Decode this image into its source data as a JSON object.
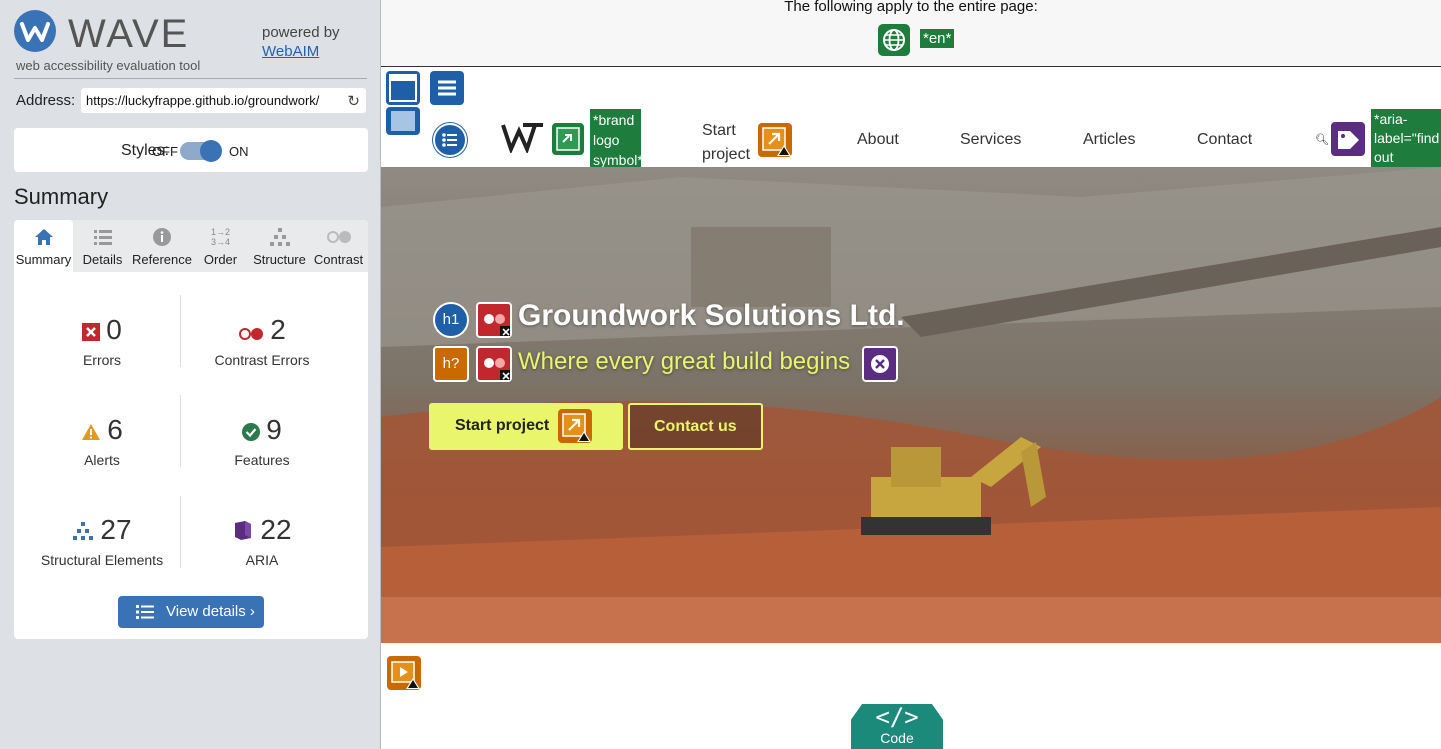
{
  "wave": {
    "title": "WAVE",
    "subtitle": "web accessibility evaluation tool",
    "powered_by": "powered by",
    "webaim_link": "WebAIM",
    "address_label": "Address:",
    "address_value": "https://luckyfrappe.github.io/groundwork/",
    "styles_label": "Styles:",
    "styles_off": "OFF",
    "styles_on": "ON",
    "summary_heading": "Summary",
    "tabs": [
      {
        "label": "Summary",
        "icon": "home-icon"
      },
      {
        "label": "Details",
        "icon": "list-icon"
      },
      {
        "label": "Reference",
        "icon": "info-icon"
      },
      {
        "label": "Order",
        "icon": "order-icon"
      },
      {
        "label": "Structure",
        "icon": "structure-icon"
      },
      {
        "label": "Contrast",
        "icon": "contrast-icon"
      }
    ],
    "stats": {
      "errors": {
        "count": "0",
        "label": "Errors"
      },
      "contrast_errors": {
        "count": "2",
        "label": "Contrast Errors"
      },
      "alerts": {
        "count": "6",
        "label": "Alerts"
      },
      "features": {
        "count": "9",
        "label": "Features"
      },
      "structural": {
        "count": "27",
        "label": "Structural Elements"
      },
      "aria": {
        "count": "22",
        "label": "ARIA"
      }
    },
    "view_details": "View details ›"
  },
  "page": {
    "banner_text": "The following apply to the entire page:",
    "lang_tag": "*en*",
    "brand_tag": "*brand logo symbol*",
    "aria_tag": "*aria-label=\"find out more\"*",
    "nav": {
      "start_project": "Start project",
      "about": "About",
      "services": "Services",
      "articles": "Articles",
      "contact": "Contact"
    },
    "hero": {
      "title": "Groundwork Solutions Ltd.",
      "subtitle": "Where every great build begins",
      "btn_start": "Start project",
      "btn_contact": "Contact us"
    },
    "code_label": "Code",
    "code_glyph": "</>",
    "wave_icons": [
      "h1",
      "h?"
    ]
  },
  "colors": {
    "wave_blue": "#3a72b6",
    "feature_green": "#1e7c3c",
    "hero_accent": "#e9f56a",
    "code_teal": "#1b8a7a"
  }
}
